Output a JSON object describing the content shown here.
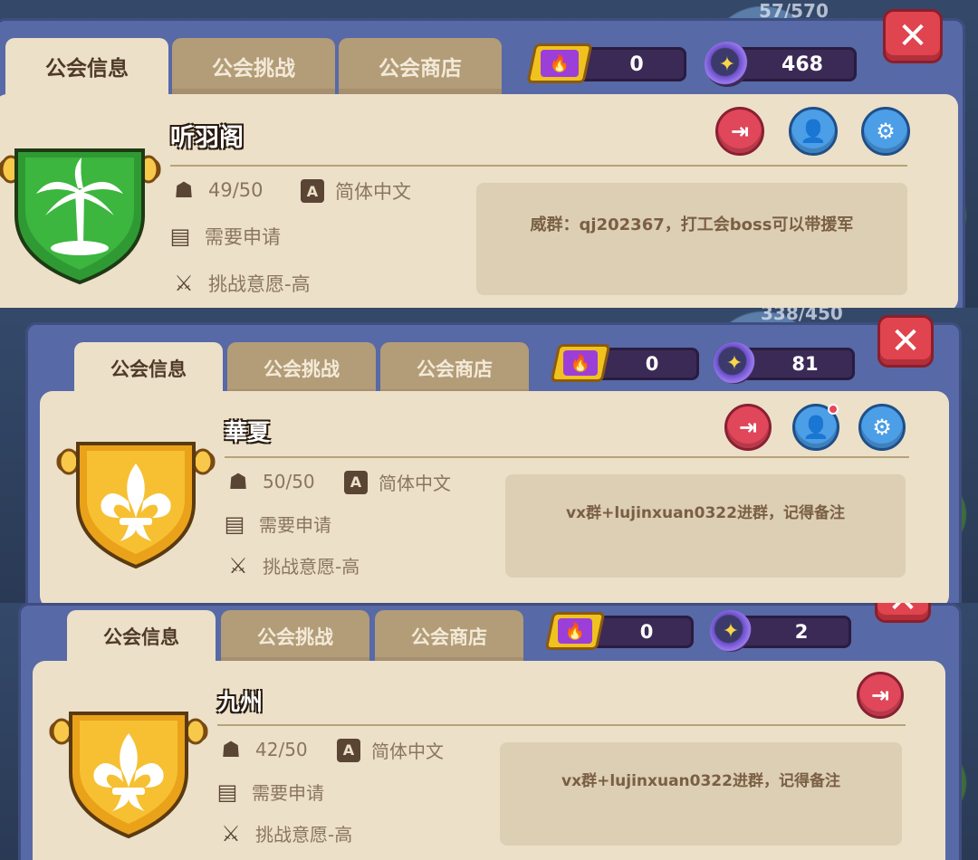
{
  "top_counts": [
    "57/570",
    "338/450"
  ],
  "tabs": [
    "公会信息",
    "公会挑战",
    "公会商店"
  ],
  "icons": {
    "ticket": "flame-ticket-icon",
    "coin": "star-coin-icon",
    "close": "close-icon",
    "leave": "exit-door-icon",
    "members": "person-icon",
    "settings": "gear-icon",
    "member_count": "people-icon",
    "language": "language-a-icon",
    "join_type": "scroll-icon",
    "challenge": "sword-icon"
  },
  "colors": {
    "panel": "#ece0c8",
    "frame": "#5769a6",
    "close": "#e0444f",
    "green_shield": "#2f9a33",
    "gold_shield": "#f0b420"
  },
  "panels": [
    {
      "guild_name": "听羽阁",
      "ticket_value": "0",
      "coin_value": "468",
      "members": "49/50",
      "language": "简体中文",
      "join_type": "需要申请",
      "challenge_will": "挑战意愿-高",
      "notice": "威群：qj202367，打工会boss可以带援军",
      "emblem": "palm-tree",
      "emblem_color": "green"
    },
    {
      "guild_name": "華夏",
      "ticket_value": "0",
      "coin_value": "81",
      "members": "50/50",
      "language": "简体中文",
      "join_type": "需要申请",
      "challenge_will": "挑战意愿-高",
      "notice": "vx群+lujinxuan0322进群，记得备注",
      "emblem": "fleur-de-lis",
      "emblem_color": "gold"
    },
    {
      "guild_name": "九州",
      "ticket_value": "0",
      "coin_value": "2",
      "members": "42/50",
      "language": "简体中文",
      "join_type": "需要申请",
      "challenge_will": "挑战意愿-高",
      "notice": "vx群+lujinxuan0322进群，记得备注",
      "emblem": "fleur-de-lis",
      "emblem_color": "gold"
    }
  ]
}
